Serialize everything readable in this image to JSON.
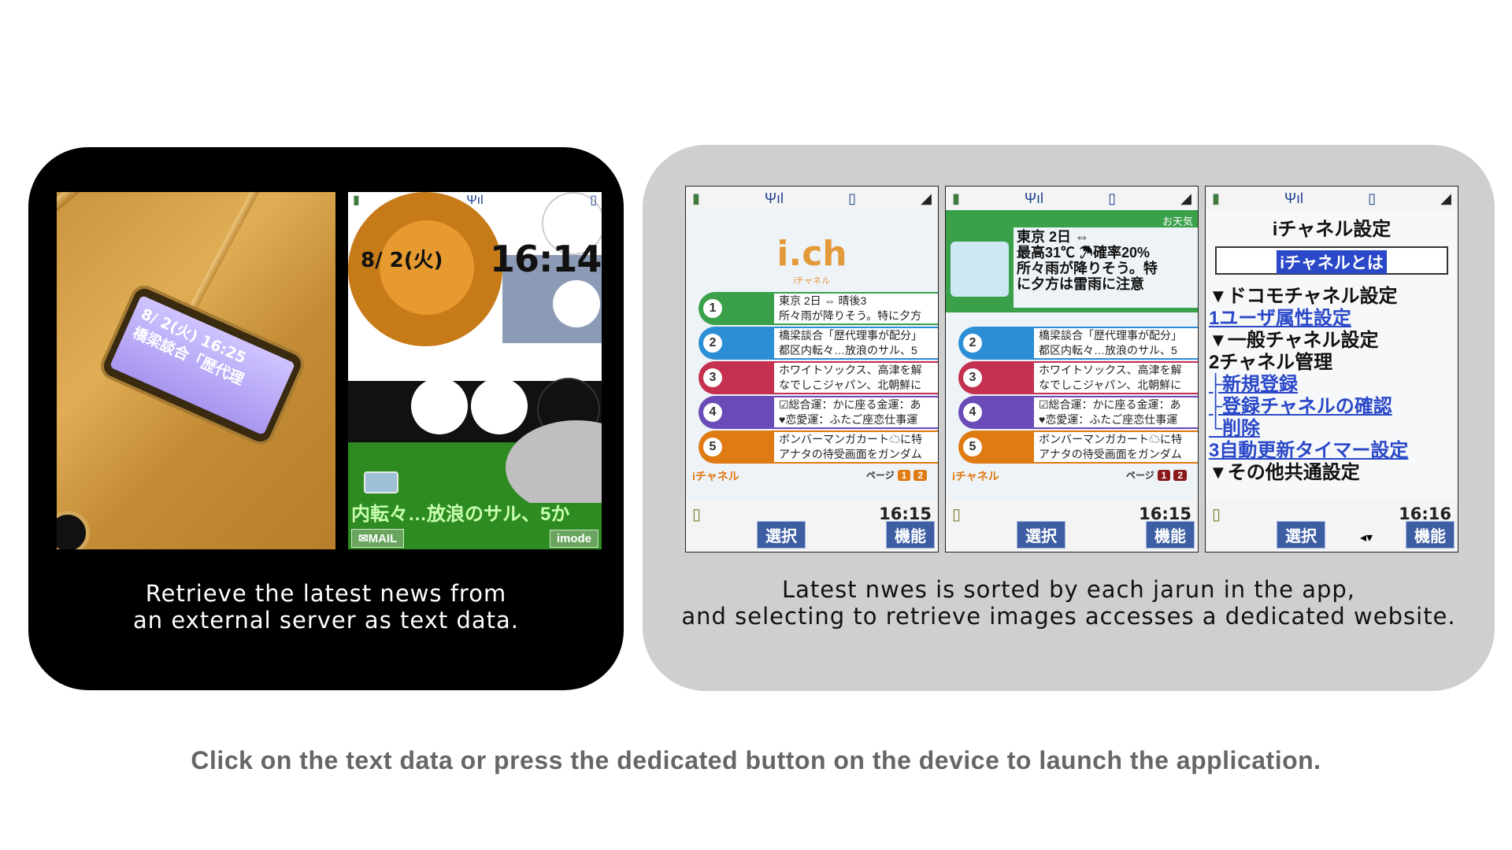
{
  "left_panel": {
    "caption_line1": "Retrieve the latest news from",
    "caption_line2": "an external server as text data.",
    "sub_display": {
      "line1": "8/ 2(火)  16:25",
      "line2": "橋梁談合「歴代理"
    },
    "standby": {
      "date": "8/ 2(火)",
      "time": "16:14",
      "ticker": "内転々…放浪のサル、5か",
      "softkey_left": "✉MAIL",
      "softkey_right": "imode"
    }
  },
  "right_panel": {
    "caption_line1": "Latest nwes is sorted by each jarun in the app,",
    "caption_line2": "and selecting to retrieve images accesses a dedicated website.",
    "screen1": {
      "logo": "i.ch",
      "logo_sub": "iチャネル",
      "rows": [
        {
          "num": "1",
          "line1": "東京 2日 ⇔    晴後3",
          "line2": "所々雨が降りそう。特に夕方"
        },
        {
          "num": "2",
          "line1": "橋梁談合「歴代理事が配分」",
          "line2": "都区内転々…放浪のサル、5"
        },
        {
          "num": "3",
          "line1": "ホワイトソックス、高津を解",
          "line2": "なでしこジャパン、北朝鮮に"
        },
        {
          "num": "4",
          "line1": "☑総合運：かに座る金運：あ",
          "line2": "♥恋愛運：ふたご座恋仕事運"
        },
        {
          "num": "5",
          "line1": "ボンバーマンガカート☁に特",
          "line2": "アナタの待受画面をガンダム"
        }
      ],
      "footer_label": "iチャネル",
      "page_label": "ページ",
      "page_1": "1",
      "page_2": "2",
      "clock": "16:15",
      "btn_select": "選択",
      "btn_func": "機能"
    },
    "screen2": {
      "weather_tag": "お天気",
      "weather_line1": "東京 2日 ⇔",
      "weather_line2": "最高31℃ ☂確率20%",
      "weather_line3": "所々雨が降りそう。特",
      "weather_line4": "に夕方は雷雨に注意",
      "rows": [
        {
          "num": "2",
          "line1": "橋梁談合「歴代理事が配分」",
          "line2": "都区内転々…放浪のサル、5"
        },
        {
          "num": "3",
          "line1": "ホワイトソックス、高津を解",
          "line2": "なでしこジャパン、北朝鮮に"
        },
        {
          "num": "4",
          "line1": "☑総合運：かに座る金運：あ",
          "line2": "♥恋愛運：ふたご座恋仕事運"
        },
        {
          "num": "5",
          "line1": "ボンバーマンガカート☁に特",
          "line2": "アナタの待受画面をガンダム"
        }
      ],
      "footer_label": "iチャネル",
      "page_label": "ページ",
      "page_1": "1",
      "page_2": "2",
      "clock": "16:15",
      "btn_select": "選択",
      "btn_func": "機能"
    },
    "screen3": {
      "title": "iチャネル設定",
      "selected": "iチャネルとは",
      "items": [
        {
          "text": "▼ドコモチャネル設定",
          "link": false
        },
        {
          "text": "1ユーザ属性設定",
          "link": true
        },
        {
          "text": "▼一般チャネル設定",
          "link": false
        },
        {
          "text": "2チャネル管理",
          "link": false
        },
        {
          "text": "├新規登録",
          "link": true
        },
        {
          "text": "├登録チャネルの確認",
          "link": true
        },
        {
          "text": "└削除",
          "link": true
        },
        {
          "text": "3自動更新タイマー設定",
          "link": true
        },
        {
          "text": "▼その他共通設定",
          "link": false
        }
      ],
      "clock": "16:16",
      "btn_select": "選択",
      "btn_func": "機能"
    }
  },
  "bottom_note": "Click on the text data or press the dedicated button on the device to launch the application.",
  "colors": {
    "row1": "#3aa04a",
    "row2": "#2c8fd6",
    "row3": "#c4304e",
    "row4": "#6a4bb8",
    "row5": "#e07a12"
  }
}
